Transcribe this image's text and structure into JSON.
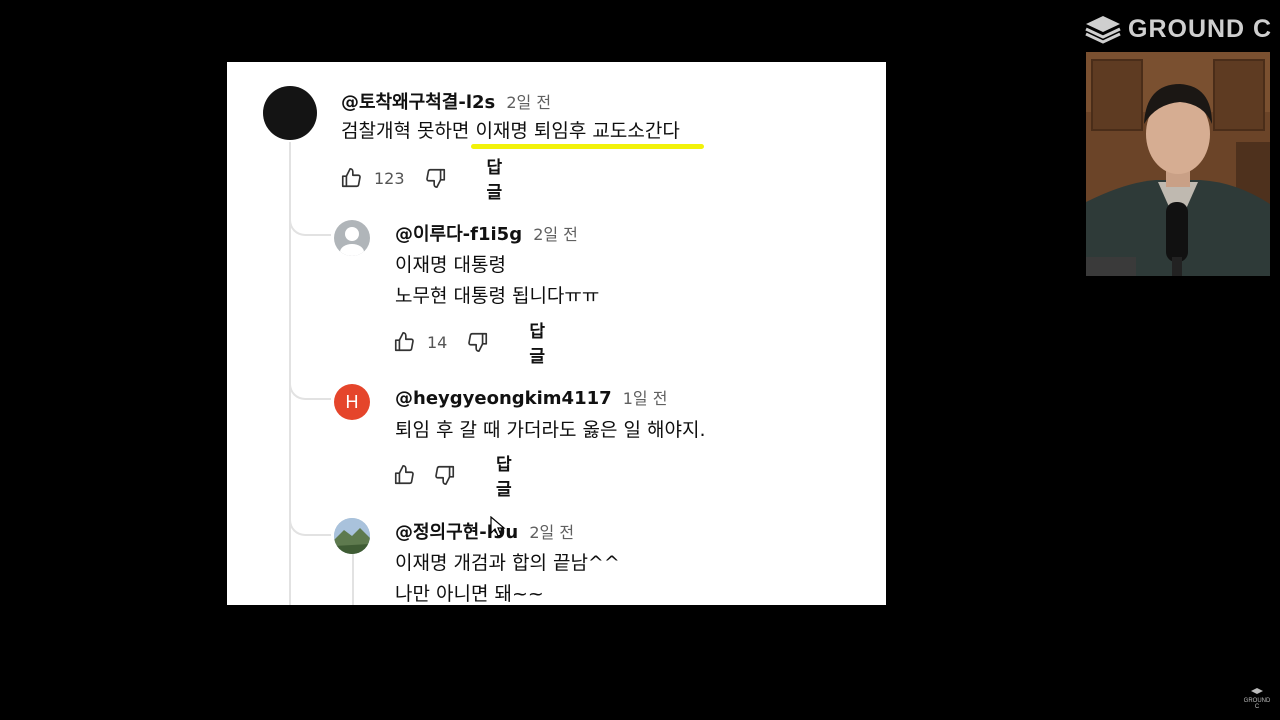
{
  "logo": {
    "text": "GROUND C",
    "icon": "stack-layers-icon"
  },
  "watermark": {
    "text": "GROUND C"
  },
  "comments": [
    {
      "author": "@토착왜구척결-l2s",
      "time": "2일 전",
      "body_before": "검찰개혁 못하면 ",
      "body_highlight": "이재명 퇴임후 교도소간다",
      "likes": "123",
      "reply": "답글",
      "avatar_color": "#141414"
    },
    {
      "author": "@이루다-f1i5g",
      "time": "2일 전",
      "lines": [
        "이재명 대통령",
        "노무현 대통령 됩니다ㅠㅠ"
      ],
      "likes": "14",
      "reply": "답글",
      "avatar_color": "#b0b5b9"
    },
    {
      "author": "@heygyeongkim4117",
      "time": "1일 전",
      "lines": [
        "퇴임 후 갈 때 가더라도 옳은 일 해야지."
      ],
      "likes": "",
      "reply": "답글",
      "avatar_letter": "H",
      "avatar_color": "#e5452b"
    },
    {
      "author": "@정의구현-l9u",
      "time": "2일 전",
      "lines": [
        "이재명 개검과 합의 끝남^^",
        "나만 아니면 돼~~"
      ]
    }
  ],
  "colors": {
    "highlight": "#f2f20a",
    "background": "#000000",
    "panel": "#ffffff"
  }
}
